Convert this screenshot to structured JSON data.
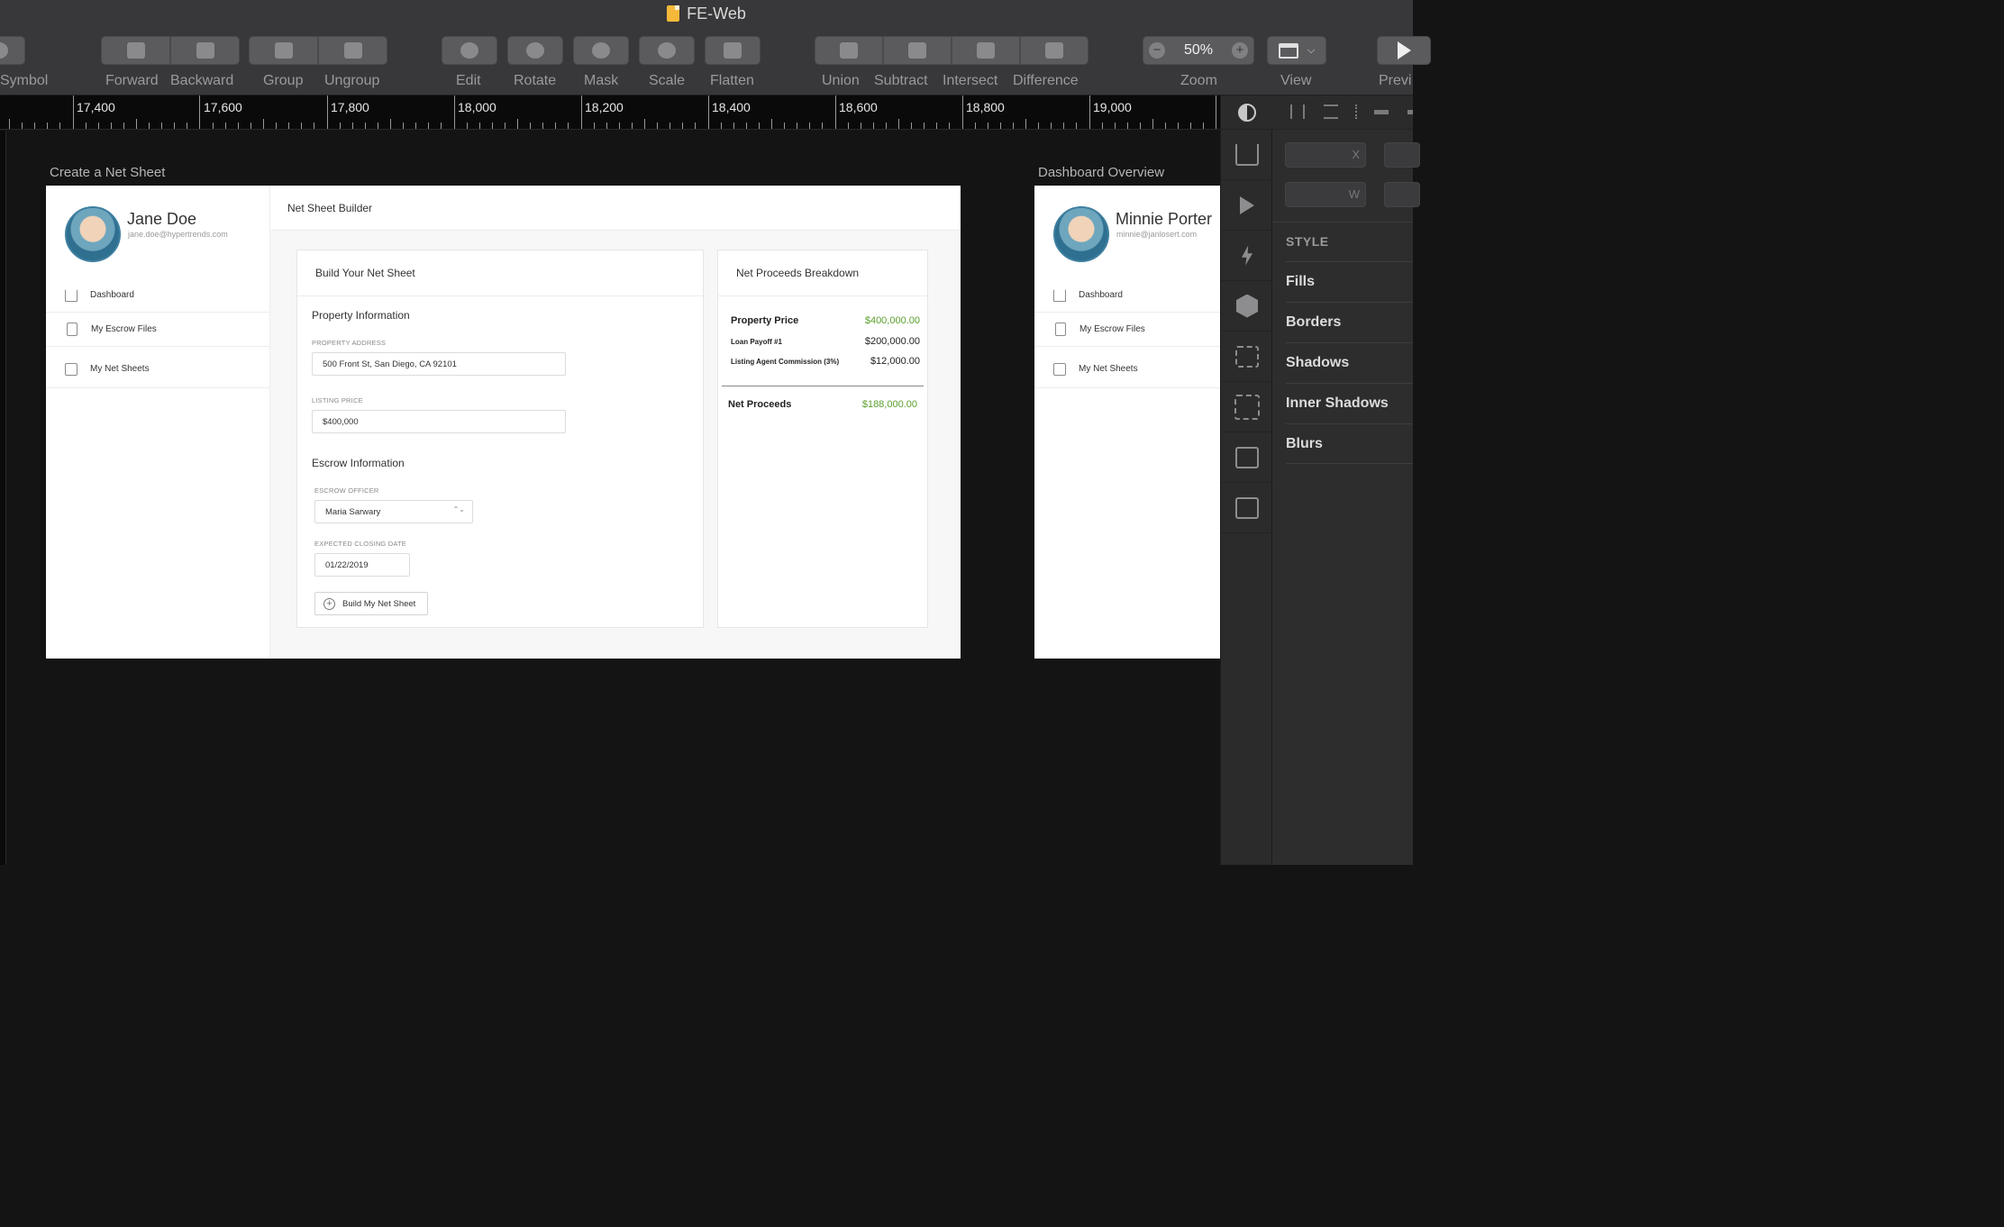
{
  "window": {
    "title": "FE-Web"
  },
  "toolbar": {
    "symbol": "Symbol",
    "forward": "Forward",
    "backward": "Backward",
    "group": "Group",
    "ungroup": "Ungroup",
    "edit": "Edit",
    "rotate": "Rotate",
    "mask": "Mask",
    "scale": "Scale",
    "flatten": "Flatten",
    "union": "Union",
    "subtract": "Subtract",
    "intersect": "Intersect",
    "difference": "Difference",
    "zoom_value": "50%",
    "zoom_minus": "−",
    "zoom_plus": "+",
    "zoom": "Zoom",
    "view": "View",
    "preview": "Previ"
  },
  "ruler": {
    "marks": [
      "17,400",
      "17,600",
      "17,800",
      "18,000",
      "18,200",
      "18,400",
      "18,600",
      "18,800",
      "19,000"
    ]
  },
  "artboards": {
    "left_title": "Create a Net Sheet",
    "right_title": "Dashboard Overview"
  },
  "netsheet": {
    "user_name": "Jane Doe",
    "user_email": "jane.doe@hypertrends.com",
    "nav": [
      "Dashboard",
      "My Escrow Files",
      "My Net Sheets"
    ],
    "header": "Net Sheet Builder",
    "build_card_title": "Build Your Net Sheet",
    "property_section": "Property Information",
    "address_label": "PROPERTY ADDRESS",
    "address_value": "500 Front St, San Diego, CA 92101",
    "price_label": "LISTING PRICE",
    "price_value": "$400,000",
    "escrow_section": "Escrow Information",
    "officer_label": "ESCROW OFFICER",
    "officer_value": "Maria Sarwary",
    "select_arrow": "⌃⌄",
    "closing_label": "EXPECTED CLOSING DATE",
    "closing_value": "01/22/2019",
    "build_button": "Build My Net Sheet",
    "build_button_icon": "+",
    "breakdown_title": "Net Proceeds Breakdown",
    "rows": [
      {
        "label": "Property Price",
        "value": "$400,000.00"
      },
      {
        "label": "Loan Payoff #1",
        "value": "$200,000.00"
      },
      {
        "label": "Listing Agent Commission (3%)",
        "value": "$12,000.00"
      }
    ],
    "net_label": "Net Proceeds",
    "net_value": "$188,000.00"
  },
  "dashboard": {
    "user_name": "Minnie Porter",
    "user_email": "minnie@janlosert.com",
    "nav": [
      "Dashboard",
      "My Escrow Files",
      "My Net Sheets"
    ]
  },
  "inspector": {
    "x_label": "X",
    "w_label": "W",
    "style": "STYLE",
    "sections": [
      "Fills",
      "Borders",
      "Shadows",
      "Inner Shadows",
      "Blurs"
    ]
  },
  "colors": {
    "accent_green": "#5aa02c",
    "canvas": "#141415",
    "toolbar": "#38383a"
  },
  "icons": [
    "sketch-doc-icon",
    "home-icon",
    "file-icon",
    "inbox-icon",
    "plus-circle-icon",
    "export-icon",
    "play-icon",
    "lightning-icon",
    "hexagon-icon",
    "layout-icon",
    "select-icon",
    "edit-icon",
    "image-icon"
  ]
}
